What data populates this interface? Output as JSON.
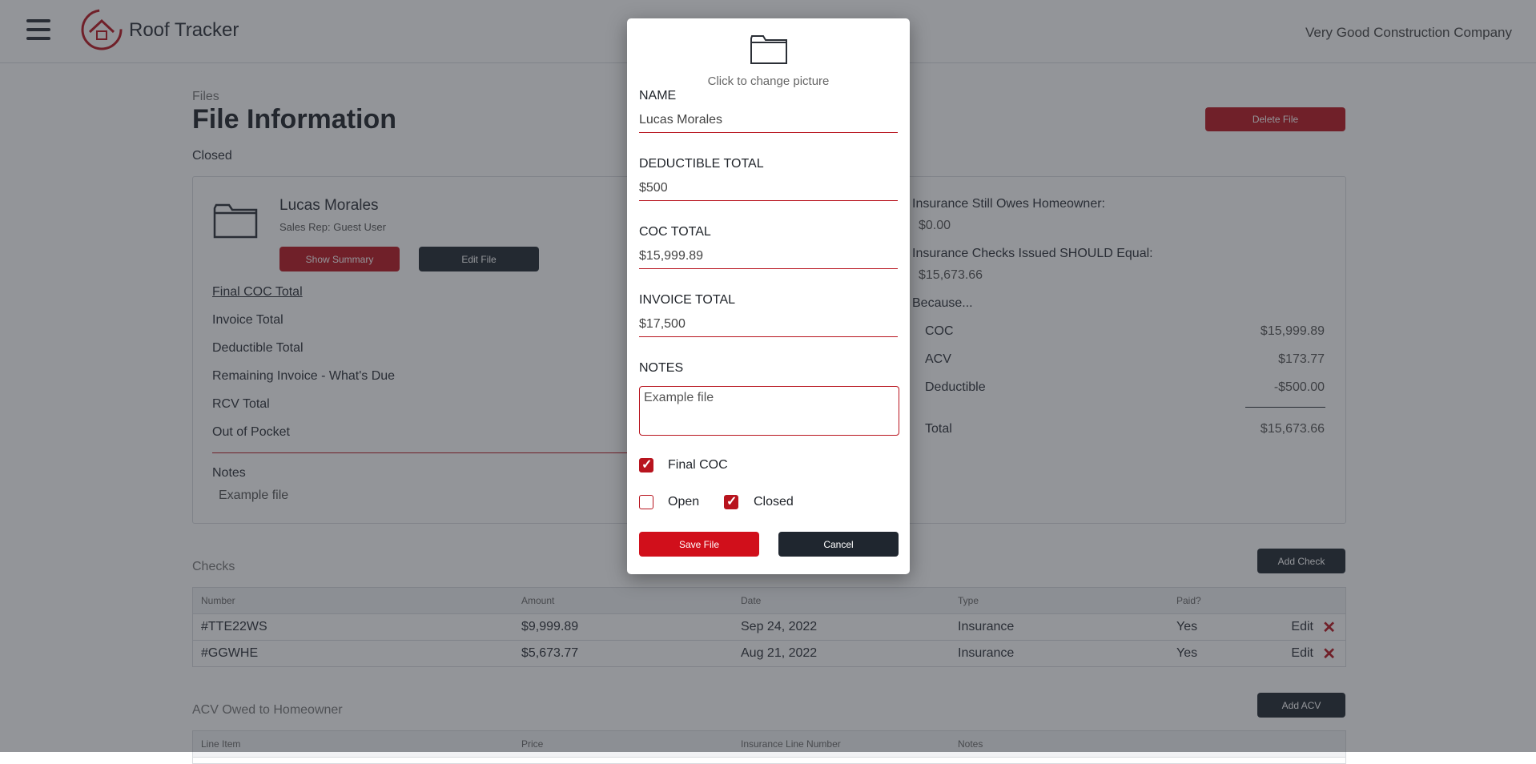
{
  "header": {
    "app_title": "Roof Tracker",
    "company": "Very Good Construction Company"
  },
  "page": {
    "breadcrumb": "Files",
    "title": "File Information",
    "status": "Closed",
    "delete_label": "Delete File"
  },
  "file": {
    "client_name": "Lucas Morales",
    "sales_rep": "Sales Rep: Guest User",
    "show_summary_label": "Show Summary",
    "edit_label": "Edit File",
    "rows": [
      "Final COC Total",
      "Invoice Total",
      "Deductible Total",
      "Remaining Invoice - What's Due",
      "RCV Total",
      "Out of Pocket"
    ],
    "notes_label": "Notes",
    "notes_value": "Example file"
  },
  "summary": {
    "still_owes_label": "Insurance Still Owes Homeowner:",
    "still_owes_value": "$0.00",
    "should_equal_label": "Insurance Checks Issued SHOULD Equal:",
    "should_equal_value": "$15,673.66",
    "because_label": "Because...",
    "lines": [
      {
        "label": "COC",
        "value": "$15,999.89"
      },
      {
        "label": "ACV",
        "value": "$173.77"
      },
      {
        "label": "Deductible",
        "value": "-$500.00"
      }
    ],
    "total_label": "Total",
    "total_value": "$15,673.66"
  },
  "checks": {
    "title": "Checks",
    "add_label": "Add Check",
    "headers": [
      "Number",
      "Amount",
      "Date",
      "Type",
      "Paid?"
    ],
    "rows": [
      {
        "number": "#TTE22WS",
        "amount": "$9,999.89",
        "date": "Sep 24, 2022",
        "type": "Insurance",
        "paid": "Yes",
        "edit": "Edit"
      },
      {
        "number": "#GGWHE",
        "amount": "$5,673.77",
        "date": "Aug 21, 2022",
        "type": "Insurance",
        "paid": "Yes",
        "edit": "Edit"
      }
    ]
  },
  "acv": {
    "title": "ACV Owed to Homeowner",
    "add_label": "Add ACV",
    "headers": [
      "Line Item",
      "Price",
      "Insurance Line Number",
      "Notes"
    ]
  },
  "modal": {
    "change_picture": "Click to change picture",
    "name_label": "NAME",
    "name_value": "Lucas Morales",
    "deductible_label": "DEDUCTIBLE TOTAL",
    "deductible_value": "$500",
    "coc_label": "COC TOTAL",
    "coc_value": "$15,999.89",
    "invoice_label": "INVOICE TOTAL",
    "invoice_value": "$17,500",
    "notes_label": "NOTES",
    "notes_value": "Example file",
    "final_coc_label": "Final COC",
    "final_coc_checked": true,
    "open_label": "Open",
    "open_checked": false,
    "closed_label": "Closed",
    "closed_checked": true,
    "save_label": "Save File",
    "cancel_label": "Cancel"
  },
  "colors": {
    "accent_red": "#b8141e",
    "dark_button": "#1f262f",
    "overlay": "rgba(40,44,52,0.5)"
  },
  "icons": [
    "menu-icon",
    "roof-logo-icon",
    "folder-icon",
    "close-x-icon",
    "checkmark-icon"
  ]
}
